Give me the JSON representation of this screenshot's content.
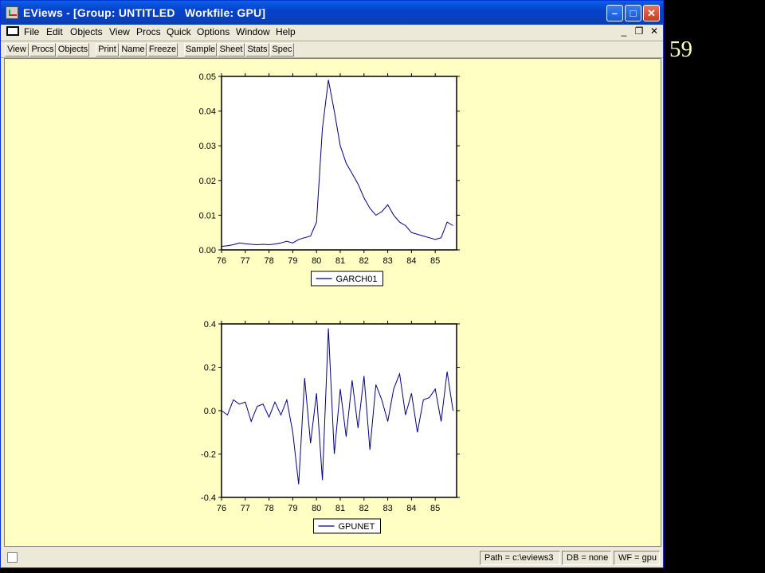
{
  "window": {
    "title": "EViews - [Group: UNTITLED   Workfile: GPU]",
    "buttons": {
      "minimize": "–",
      "maximize": "□",
      "close": "✕"
    }
  },
  "menu": {
    "items": [
      "File",
      "Edit",
      "Objects",
      "View",
      "Procs",
      "Quick",
      "Options",
      "Window",
      "Help"
    ],
    "mdi": {
      "minimize": "_",
      "restore": "❐",
      "close": "✕"
    }
  },
  "toolbar": {
    "buttons": [
      "View",
      "Procs",
      "Objects",
      "Print",
      "Name",
      "Freeze",
      "Sample",
      "Sheet",
      "Stats",
      "Spec"
    ]
  },
  "status": {
    "path": "Path = c:\\eviews3",
    "db": "DB = none",
    "wf": "WF = gpu"
  },
  "slide_number": "59",
  "colors": {
    "series": "#000080",
    "content_bg": "#ffffc4",
    "titlebar": "#0a5fe8"
  },
  "chart_data": [
    {
      "type": "line",
      "x": [
        76.0,
        76.25,
        76.5,
        76.75,
        77.0,
        77.25,
        77.5,
        77.75,
        78.0,
        78.25,
        78.5,
        78.75,
        79.0,
        79.25,
        79.5,
        79.75,
        80.0,
        80.25,
        80.5,
        80.75,
        81.0,
        81.25,
        81.5,
        81.75,
        82.0,
        82.25,
        82.5,
        82.75,
        83.0,
        83.25,
        83.5,
        83.75,
        84.0,
        84.25,
        84.5,
        84.75,
        85.0,
        85.25,
        85.5,
        85.75
      ],
      "series": [
        {
          "name": "GARCH01",
          "values": [
            0.001,
            0.0012,
            0.0015,
            0.002,
            0.0018,
            0.0016,
            0.0015,
            0.0016,
            0.0015,
            0.0017,
            0.002,
            0.0025,
            0.002,
            0.003,
            0.0035,
            0.004,
            0.008,
            0.035,
            0.049,
            0.04,
            0.03,
            0.025,
            0.022,
            0.019,
            0.015,
            0.012,
            0.01,
            0.011,
            0.013,
            0.01,
            0.008,
            0.007,
            0.005,
            0.0045,
            0.004,
            0.0035,
            0.003,
            0.0035,
            0.008,
            0.007
          ]
        }
      ],
      "xticks": [
        "76",
        "77",
        "78",
        "79",
        "80",
        "81",
        "82",
        "83",
        "84",
        "85"
      ],
      "yticks": [
        "0.00",
        "0.01",
        "0.02",
        "0.03",
        "0.04",
        "0.05"
      ],
      "ylim": [
        0,
        0.05
      ],
      "xlim": [
        76,
        85.9
      ],
      "legend": "bottom-center"
    },
    {
      "type": "line",
      "x": [
        76.0,
        76.25,
        76.5,
        76.75,
        77.0,
        77.25,
        77.5,
        77.75,
        78.0,
        78.25,
        78.5,
        78.75,
        79.0,
        79.25,
        79.5,
        79.75,
        80.0,
        80.25,
        80.5,
        80.75,
        81.0,
        81.25,
        81.5,
        81.75,
        82.0,
        82.25,
        82.5,
        82.75,
        83.0,
        83.25,
        83.5,
        83.75,
        84.0,
        84.25,
        84.5,
        84.75,
        85.0,
        85.25,
        85.5,
        85.75
      ],
      "series": [
        {
          "name": "GPUNET",
          "values": [
            0.0,
            -0.02,
            0.05,
            0.03,
            0.04,
            -0.05,
            0.02,
            0.03,
            -0.03,
            0.04,
            -0.02,
            0.05,
            -0.1,
            -0.34,
            0.15,
            -0.15,
            0.08,
            -0.32,
            0.38,
            -0.2,
            0.1,
            -0.12,
            0.14,
            -0.08,
            0.16,
            -0.18,
            0.12,
            0.05,
            -0.05,
            0.1,
            0.17,
            -0.02,
            0.08,
            -0.1,
            0.05,
            0.06,
            0.1,
            -0.05,
            0.18,
            0.0
          ]
        }
      ],
      "xticks": [
        "76",
        "77",
        "78",
        "79",
        "80",
        "81",
        "82",
        "83",
        "84",
        "85"
      ],
      "yticks": [
        "-0.4",
        "-0.2",
        "0.0",
        "0.2",
        "0.4"
      ],
      "ylim": [
        -0.4,
        0.4
      ],
      "xlim": [
        76,
        85.9
      ],
      "legend": "bottom-center"
    }
  ]
}
